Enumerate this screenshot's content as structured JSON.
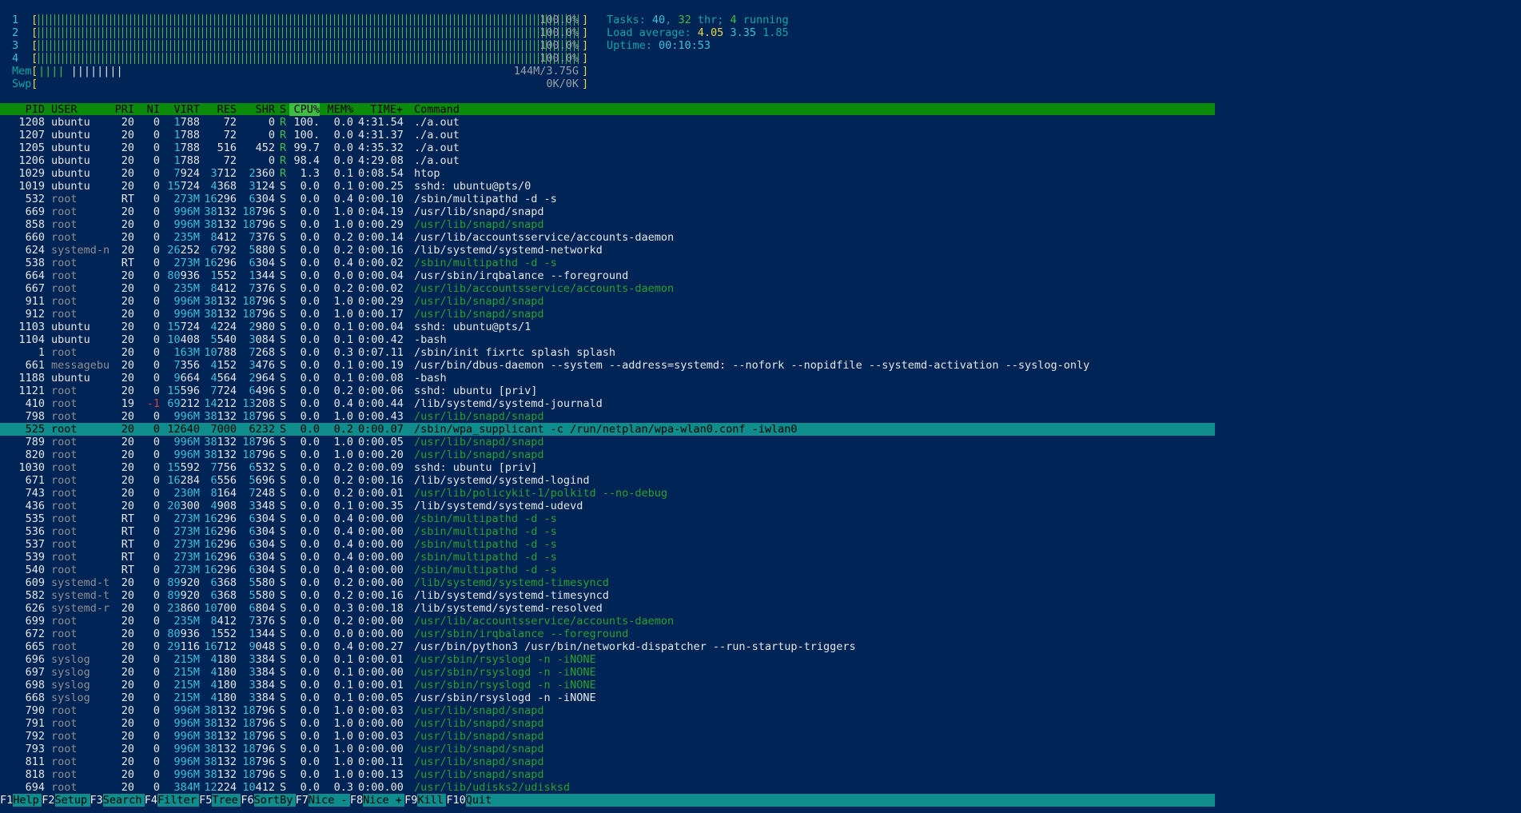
{
  "cpu_meters": [
    {
      "label": "1",
      "value": "100.0%",
      "percent": 100
    },
    {
      "label": "2",
      "value": "100.0%",
      "percent": 100
    },
    {
      "label": "3",
      "value": "100.0%",
      "percent": 100
    },
    {
      "label": "4",
      "value": "100.0%",
      "percent": 100
    }
  ],
  "mem": {
    "label": "Mem",
    "value": "144M/3.75G"
  },
  "swp": {
    "label": "Swp",
    "value": "0K/0K"
  },
  "summary": {
    "tasks_label": "Tasks: ",
    "tasks": "40",
    "sep1": ", ",
    "threads": "32",
    "thr_label": " thr; ",
    "running": "4",
    "running_label": " running",
    "load_label": "Load average: ",
    "load1": "4.05",
    "load5": "3.35",
    "load15": "1.85",
    "uptime_label": "Uptime: ",
    "uptime": "00:10:53"
  },
  "columns": {
    "pid": "PID",
    "user": "USER",
    "pri": "PRI",
    "ni": "NI",
    "virt": "VIRT",
    "res": "RES",
    "shr": "SHR",
    "s": "S",
    "cpu": "CPU%",
    "mem": "MEM%",
    "time": "TIME+",
    "command": "Command"
  },
  "processes": [
    {
      "pid": "1208",
      "user": "ubuntu",
      "pri": "20",
      "ni": "0",
      "virt": "1788",
      "res": "72",
      "shr": "0",
      "s": "R",
      "cpu": "100.",
      "mem": "0.0",
      "time": "4:31.54",
      "cmd": "./a.out",
      "thread": false
    },
    {
      "pid": "1207",
      "user": "ubuntu",
      "pri": "20",
      "ni": "0",
      "virt": "1788",
      "res": "72",
      "shr": "0",
      "s": "R",
      "cpu": "100.",
      "mem": "0.0",
      "time": "4:31.37",
      "cmd": "./a.out",
      "thread": false
    },
    {
      "pid": "1205",
      "user": "ubuntu",
      "pri": "20",
      "ni": "0",
      "virt": "1788",
      "res": "516",
      "shr": "452",
      "s": "R",
      "cpu": "99.7",
      "mem": "0.0",
      "time": "4:35.32",
      "cmd": "./a.out",
      "thread": false
    },
    {
      "pid": "1206",
      "user": "ubuntu",
      "pri": "20",
      "ni": "0",
      "virt": "1788",
      "res": "72",
      "shr": "0",
      "s": "R",
      "cpu": "98.4",
      "mem": "0.0",
      "time": "4:29.08",
      "cmd": "./a.out",
      "thread": false
    },
    {
      "pid": "1029",
      "user": "ubuntu",
      "pri": "20",
      "ni": "0",
      "virt": "7924",
      "res": "3712",
      "shr": "2360",
      "s": "R",
      "cpu": "1.3",
      "mem": "0.1",
      "time": "0:08.54",
      "cmd": "htop",
      "thread": false
    },
    {
      "pid": "1019",
      "user": "ubuntu",
      "pri": "20",
      "ni": "0",
      "virt": "15724",
      "res": "4368",
      "shr": "3124",
      "s": "S",
      "cpu": "0.0",
      "mem": "0.1",
      "time": "0:00.25",
      "cmd": "sshd: ubuntu@pts/0",
      "thread": false
    },
    {
      "pid": "532",
      "user": "root",
      "pri": "RT",
      "ni": "0",
      "virt": "273M",
      "res": "16296",
      "shr": "6304",
      "s": "S",
      "cpu": "0.0",
      "mem": "0.4",
      "time": "0:00.10",
      "cmd": "/sbin/multipathd -d -s",
      "thread": false
    },
    {
      "pid": "669",
      "user": "root",
      "pri": "20",
      "ni": "0",
      "virt": "996M",
      "res": "38132",
      "shr": "18796",
      "s": "S",
      "cpu": "0.0",
      "mem": "1.0",
      "time": "0:04.19",
      "cmd": "/usr/lib/snapd/snapd",
      "thread": false
    },
    {
      "pid": "858",
      "user": "root",
      "pri": "20",
      "ni": "0",
      "virt": "996M",
      "res": "38132",
      "shr": "18796",
      "s": "S",
      "cpu": "0.0",
      "mem": "1.0",
      "time": "0:00.29",
      "cmd": "/usr/lib/snapd/snapd",
      "thread": true
    },
    {
      "pid": "660",
      "user": "root",
      "pri": "20",
      "ni": "0",
      "virt": "235M",
      "res": "8412",
      "shr": "7376",
      "s": "S",
      "cpu": "0.0",
      "mem": "0.2",
      "time": "0:00.14",
      "cmd": "/usr/lib/accountsservice/accounts-daemon",
      "thread": false
    },
    {
      "pid": "624",
      "user": "systemd-n",
      "pri": "20",
      "ni": "0",
      "virt": "26252",
      "res": "6792",
      "shr": "5880",
      "s": "S",
      "cpu": "0.0",
      "mem": "0.2",
      "time": "0:00.16",
      "cmd": "/lib/systemd/systemd-networkd",
      "thread": false
    },
    {
      "pid": "538",
      "user": "root",
      "pri": "RT",
      "ni": "0",
      "virt": "273M",
      "res": "16296",
      "shr": "6304",
      "s": "S",
      "cpu": "0.0",
      "mem": "0.4",
      "time": "0:00.02",
      "cmd": "/sbin/multipathd -d -s",
      "thread": true
    },
    {
      "pid": "664",
      "user": "root",
      "pri": "20",
      "ni": "0",
      "virt": "80936",
      "res": "1552",
      "shr": "1344",
      "s": "S",
      "cpu": "0.0",
      "mem": "0.0",
      "time": "0:00.04",
      "cmd": "/usr/sbin/irqbalance --foreground",
      "thread": false
    },
    {
      "pid": "667",
      "user": "root",
      "pri": "20",
      "ni": "0",
      "virt": "235M",
      "res": "8412",
      "shr": "7376",
      "s": "S",
      "cpu": "0.0",
      "mem": "0.2",
      "time": "0:00.02",
      "cmd": "/usr/lib/accountsservice/accounts-daemon",
      "thread": true
    },
    {
      "pid": "911",
      "user": "root",
      "pri": "20",
      "ni": "0",
      "virt": "996M",
      "res": "38132",
      "shr": "18796",
      "s": "S",
      "cpu": "0.0",
      "mem": "1.0",
      "time": "0:00.29",
      "cmd": "/usr/lib/snapd/snapd",
      "thread": true
    },
    {
      "pid": "912",
      "user": "root",
      "pri": "20",
      "ni": "0",
      "virt": "996M",
      "res": "38132",
      "shr": "18796",
      "s": "S",
      "cpu": "0.0",
      "mem": "1.0",
      "time": "0:00.17",
      "cmd": "/usr/lib/snapd/snapd",
      "thread": true
    },
    {
      "pid": "1103",
      "user": "ubuntu",
      "pri": "20",
      "ni": "0",
      "virt": "15724",
      "res": "4224",
      "shr": "2980",
      "s": "S",
      "cpu": "0.0",
      "mem": "0.1",
      "time": "0:00.04",
      "cmd": "sshd: ubuntu@pts/1",
      "thread": false
    },
    {
      "pid": "1104",
      "user": "ubuntu",
      "pri": "20",
      "ni": "0",
      "virt": "10408",
      "res": "5540",
      "shr": "3084",
      "s": "S",
      "cpu": "0.0",
      "mem": "0.1",
      "time": "0:00.42",
      "cmd": "-bash",
      "thread": false
    },
    {
      "pid": "1",
      "user": "root",
      "pri": "20",
      "ni": "0",
      "virt": "163M",
      "res": "10788",
      "shr": "7268",
      "s": "S",
      "cpu": "0.0",
      "mem": "0.3",
      "time": "0:07.11",
      "cmd": "/sbin/init fixrtc splash splash",
      "thread": false
    },
    {
      "pid": "661",
      "user": "messagebu",
      "pri": "20",
      "ni": "0",
      "virt": "7356",
      "res": "4152",
      "shr": "3476",
      "s": "S",
      "cpu": "0.0",
      "mem": "0.1",
      "time": "0:00.19",
      "cmd": "/usr/bin/dbus-daemon --system --address=systemd: --nofork --nopidfile --systemd-activation --syslog-only",
      "thread": false
    },
    {
      "pid": "1188",
      "user": "ubuntu",
      "pri": "20",
      "ni": "0",
      "virt": "9664",
      "res": "4564",
      "shr": "2964",
      "s": "S",
      "cpu": "0.0",
      "mem": "0.1",
      "time": "0:00.08",
      "cmd": "-bash",
      "thread": false
    },
    {
      "pid": "1121",
      "user": "root",
      "pri": "20",
      "ni": "0",
      "virt": "15596",
      "res": "7724",
      "shr": "6496",
      "s": "S",
      "cpu": "0.0",
      "mem": "0.2",
      "time": "0:00.06",
      "cmd": "sshd: ubuntu [priv]",
      "thread": false
    },
    {
      "pid": "410",
      "user": "root",
      "pri": "19",
      "ni": "-1",
      "virt": "69212",
      "res": "14212",
      "shr": "13208",
      "s": "S",
      "cpu": "0.0",
      "mem": "0.4",
      "time": "0:00.44",
      "cmd": "/lib/systemd/systemd-journald",
      "thread": false
    },
    {
      "pid": "798",
      "user": "root",
      "pri": "20",
      "ni": "0",
      "virt": "996M",
      "res": "38132",
      "shr": "18796",
      "s": "S",
      "cpu": "0.0",
      "mem": "1.0",
      "time": "0:00.43",
      "cmd": "/usr/lib/snapd/snapd",
      "thread": true
    },
    {
      "pid": "525",
      "user": "root",
      "pri": "20",
      "ni": "0",
      "virt": "12640",
      "res": "7000",
      "shr": "6232",
      "s": "S",
      "cpu": "0.0",
      "mem": "0.2",
      "time": "0:00.07",
      "cmd": "/sbin/wpa_supplicant -c /run/netplan/wpa-wlan0.conf -iwlan0",
      "thread": false,
      "selected": true
    },
    {
      "pid": "789",
      "user": "root",
      "pri": "20",
      "ni": "0",
      "virt": "996M",
      "res": "38132",
      "shr": "18796",
      "s": "S",
      "cpu": "0.0",
      "mem": "1.0",
      "time": "0:00.05",
      "cmd": "/usr/lib/snapd/snapd",
      "thread": true
    },
    {
      "pid": "820",
      "user": "root",
      "pri": "20",
      "ni": "0",
      "virt": "996M",
      "res": "38132",
      "shr": "18796",
      "s": "S",
      "cpu": "0.0",
      "mem": "1.0",
      "time": "0:00.20",
      "cmd": "/usr/lib/snapd/snapd",
      "thread": true
    },
    {
      "pid": "1030",
      "user": "root",
      "pri": "20",
      "ni": "0",
      "virt": "15592",
      "res": "7756",
      "shr": "6532",
      "s": "S",
      "cpu": "0.0",
      "mem": "0.2",
      "time": "0:00.09",
      "cmd": "sshd: ubuntu [priv]",
      "thread": false
    },
    {
      "pid": "671",
      "user": "root",
      "pri": "20",
      "ni": "0",
      "virt": "16284",
      "res": "6556",
      "shr": "5696",
      "s": "S",
      "cpu": "0.0",
      "mem": "0.2",
      "time": "0:00.16",
      "cmd": "/lib/systemd/systemd-logind",
      "thread": false
    },
    {
      "pid": "743",
      "user": "root",
      "pri": "20",
      "ni": "0",
      "virt": "230M",
      "res": "8164",
      "shr": "7248",
      "s": "S",
      "cpu": "0.0",
      "mem": "0.2",
      "time": "0:00.01",
      "cmd": "/usr/lib/policykit-1/polkitd --no-debug",
      "thread": true
    },
    {
      "pid": "436",
      "user": "root",
      "pri": "20",
      "ni": "0",
      "virt": "20300",
      "res": "4908",
      "shr": "3348",
      "s": "S",
      "cpu": "0.0",
      "mem": "0.1",
      "time": "0:00.35",
      "cmd": "/lib/systemd/systemd-udevd",
      "thread": false
    },
    {
      "pid": "535",
      "user": "root",
      "pri": "RT",
      "ni": "0",
      "virt": "273M",
      "res": "16296",
      "shr": "6304",
      "s": "S",
      "cpu": "0.0",
      "mem": "0.4",
      "time": "0:00.00",
      "cmd": "/sbin/multipathd -d -s",
      "thread": true
    },
    {
      "pid": "536",
      "user": "root",
      "pri": "RT",
      "ni": "0",
      "virt": "273M",
      "res": "16296",
      "shr": "6304",
      "s": "S",
      "cpu": "0.0",
      "mem": "0.4",
      "time": "0:00.00",
      "cmd": "/sbin/multipathd -d -s",
      "thread": true
    },
    {
      "pid": "537",
      "user": "root",
      "pri": "RT",
      "ni": "0",
      "virt": "273M",
      "res": "16296",
      "shr": "6304",
      "s": "S",
      "cpu": "0.0",
      "mem": "0.4",
      "time": "0:00.00",
      "cmd": "/sbin/multipathd -d -s",
      "thread": true
    },
    {
      "pid": "539",
      "user": "root",
      "pri": "RT",
      "ni": "0",
      "virt": "273M",
      "res": "16296",
      "shr": "6304",
      "s": "S",
      "cpu": "0.0",
      "mem": "0.4",
      "time": "0:00.00",
      "cmd": "/sbin/multipathd -d -s",
      "thread": true
    },
    {
      "pid": "540",
      "user": "root",
      "pri": "RT",
      "ni": "0",
      "virt": "273M",
      "res": "16296",
      "shr": "6304",
      "s": "S",
      "cpu": "0.0",
      "mem": "0.4",
      "time": "0:00.00",
      "cmd": "/sbin/multipathd -d -s",
      "thread": true
    },
    {
      "pid": "609",
      "user": "systemd-t",
      "pri": "20",
      "ni": "0",
      "virt": "89920",
      "res": "6368",
      "shr": "5580",
      "s": "S",
      "cpu": "0.0",
      "mem": "0.2",
      "time": "0:00.00",
      "cmd": "/lib/systemd/systemd-timesyncd",
      "thread": true
    },
    {
      "pid": "582",
      "user": "systemd-t",
      "pri": "20",
      "ni": "0",
      "virt": "89920",
      "res": "6368",
      "shr": "5580",
      "s": "S",
      "cpu": "0.0",
      "mem": "0.2",
      "time": "0:00.16",
      "cmd": "/lib/systemd/systemd-timesyncd",
      "thread": false
    },
    {
      "pid": "626",
      "user": "systemd-r",
      "pri": "20",
      "ni": "0",
      "virt": "23860",
      "res": "10700",
      "shr": "6804",
      "s": "S",
      "cpu": "0.0",
      "mem": "0.3",
      "time": "0:00.18",
      "cmd": "/lib/systemd/systemd-resolved",
      "thread": false
    },
    {
      "pid": "699",
      "user": "root",
      "pri": "20",
      "ni": "0",
      "virt": "235M",
      "res": "8412",
      "shr": "7376",
      "s": "S",
      "cpu": "0.0",
      "mem": "0.2",
      "time": "0:00.00",
      "cmd": "/usr/lib/accountsservice/accounts-daemon",
      "thread": true
    },
    {
      "pid": "672",
      "user": "root",
      "pri": "20",
      "ni": "0",
      "virt": "80936",
      "res": "1552",
      "shr": "1344",
      "s": "S",
      "cpu": "0.0",
      "mem": "0.0",
      "time": "0:00.00",
      "cmd": "/usr/sbin/irqbalance --foreground",
      "thread": true
    },
    {
      "pid": "665",
      "user": "root",
      "pri": "20",
      "ni": "0",
      "virt": "29116",
      "res": "16712",
      "shr": "9048",
      "s": "S",
      "cpu": "0.0",
      "mem": "0.4",
      "time": "0:00.27",
      "cmd": "/usr/bin/python3 /usr/bin/networkd-dispatcher --run-startup-triggers",
      "thread": false
    },
    {
      "pid": "696",
      "user": "syslog",
      "pri": "20",
      "ni": "0",
      "virt": "215M",
      "res": "4180",
      "shr": "3384",
      "s": "S",
      "cpu": "0.0",
      "mem": "0.1",
      "time": "0:00.01",
      "cmd": "/usr/sbin/rsyslogd -n -iNONE",
      "thread": true
    },
    {
      "pid": "697",
      "user": "syslog",
      "pri": "20",
      "ni": "0",
      "virt": "215M",
      "res": "4180",
      "shr": "3384",
      "s": "S",
      "cpu": "0.0",
      "mem": "0.1",
      "time": "0:00.00",
      "cmd": "/usr/sbin/rsyslogd -n -iNONE",
      "thread": true
    },
    {
      "pid": "698",
      "user": "syslog",
      "pri": "20",
      "ni": "0",
      "virt": "215M",
      "res": "4180",
      "shr": "3384",
      "s": "S",
      "cpu": "0.0",
      "mem": "0.1",
      "time": "0:00.01",
      "cmd": "/usr/sbin/rsyslogd -n -iNONE",
      "thread": true
    },
    {
      "pid": "668",
      "user": "syslog",
      "pri": "20",
      "ni": "0",
      "virt": "215M",
      "res": "4180",
      "shr": "3384",
      "s": "S",
      "cpu": "0.0",
      "mem": "0.1",
      "time": "0:00.05",
      "cmd": "/usr/sbin/rsyslogd -n -iNONE",
      "thread": false
    },
    {
      "pid": "790",
      "user": "root",
      "pri": "20",
      "ni": "0",
      "virt": "996M",
      "res": "38132",
      "shr": "18796",
      "s": "S",
      "cpu": "0.0",
      "mem": "1.0",
      "time": "0:00.03",
      "cmd": "/usr/lib/snapd/snapd",
      "thread": true
    },
    {
      "pid": "791",
      "user": "root",
      "pri": "20",
      "ni": "0",
      "virt": "996M",
      "res": "38132",
      "shr": "18796",
      "s": "S",
      "cpu": "0.0",
      "mem": "1.0",
      "time": "0:00.00",
      "cmd": "/usr/lib/snapd/snapd",
      "thread": true
    },
    {
      "pid": "792",
      "user": "root",
      "pri": "20",
      "ni": "0",
      "virt": "996M",
      "res": "38132",
      "shr": "18796",
      "s": "S",
      "cpu": "0.0",
      "mem": "1.0",
      "time": "0:00.03",
      "cmd": "/usr/lib/snapd/snapd",
      "thread": true
    },
    {
      "pid": "793",
      "user": "root",
      "pri": "20",
      "ni": "0",
      "virt": "996M",
      "res": "38132",
      "shr": "18796",
      "s": "S",
      "cpu": "0.0",
      "mem": "1.0",
      "time": "0:00.00",
      "cmd": "/usr/lib/snapd/snapd",
      "thread": true
    },
    {
      "pid": "811",
      "user": "root",
      "pri": "20",
      "ni": "0",
      "virt": "996M",
      "res": "38132",
      "shr": "18796",
      "s": "S",
      "cpu": "0.0",
      "mem": "1.0",
      "time": "0:00.11",
      "cmd": "/usr/lib/snapd/snapd",
      "thread": true
    },
    {
      "pid": "818",
      "user": "root",
      "pri": "20",
      "ni": "0",
      "virt": "996M",
      "res": "38132",
      "shr": "18796",
      "s": "S",
      "cpu": "0.0",
      "mem": "1.0",
      "time": "0:00.13",
      "cmd": "/usr/lib/snapd/snapd",
      "thread": true
    },
    {
      "pid": "694",
      "user": "root",
      "pri": "20",
      "ni": "0",
      "virt": "384M",
      "res": "12224",
      "shr": "10412",
      "s": "S",
      "cpu": "0.0",
      "mem": "0.3",
      "time": "0:00.00",
      "cmd": "/usr/lib/udisks2/udisksd",
      "thread": true
    }
  ],
  "function_keys": [
    {
      "key": "F1",
      "label": "Help"
    },
    {
      "key": "F2",
      "label": "Setup"
    },
    {
      "key": "F3",
      "label": "Search"
    },
    {
      "key": "F4",
      "label": "Filter"
    },
    {
      "key": "F5",
      "label": "Tree"
    },
    {
      "key": "F6",
      "label": "SortBy"
    },
    {
      "key": "F7",
      "label": "Nice -"
    },
    {
      "key": "F8",
      "label": "Nice +"
    },
    {
      "key": "F9",
      "label": "Kill"
    },
    {
      "key": "F10",
      "label": "Quit"
    }
  ]
}
